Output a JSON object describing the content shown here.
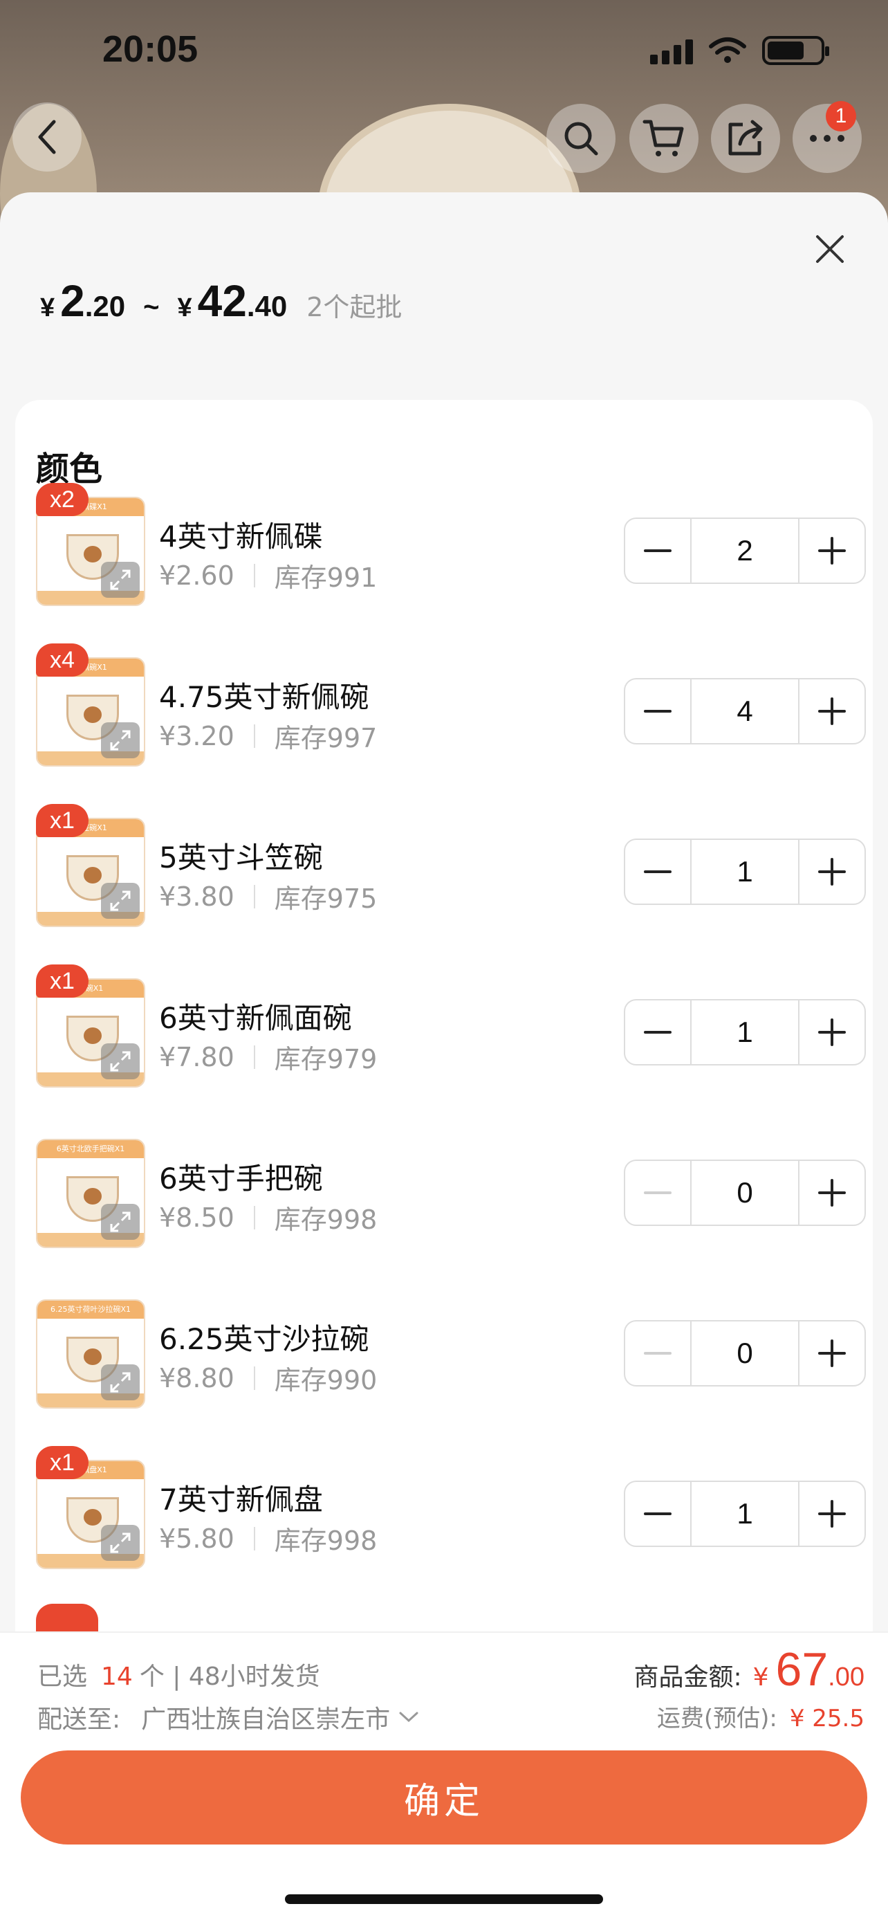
{
  "status": {
    "time": "20:05"
  },
  "header": {
    "cart_badge": "1"
  },
  "price": {
    "min_yen": "¥",
    "min_int": "2",
    "min_dec": ".20",
    "tilde": "~",
    "max_yen": "¥",
    "max_int": "42",
    "max_dec": ".40",
    "moq": "2个起批"
  },
  "section_title": "颜色",
  "items": [
    {
      "name": "4英寸新佩碟",
      "price": "¥2.60",
      "stock": "库存991",
      "qty": "2",
      "badge": "x2",
      "strip": "新佩碟X1"
    },
    {
      "name": "4.75英寸新佩碗",
      "price": "¥3.20",
      "stock": "库存997",
      "qty": "4",
      "badge": "x4",
      "strip": "新佩碗X1"
    },
    {
      "name": "5英寸斗笠碗",
      "price": "¥3.80",
      "stock": "库存975",
      "qty": "1",
      "badge": "x1",
      "strip": "斗笠碗X1"
    },
    {
      "name": "6英寸新佩面碗",
      "price": "¥7.80",
      "stock": "库存979",
      "qty": "1",
      "badge": "x1",
      "strip": "面碗X1"
    },
    {
      "name": "6英寸手把碗",
      "price": "¥8.50",
      "stock": "库存998",
      "qty": "0",
      "badge": "",
      "strip": "6英寸北欧手把碗X1"
    },
    {
      "name": "6.25英寸沙拉碗",
      "price": "¥8.80",
      "stock": "库存990",
      "qty": "0",
      "badge": "",
      "strip": "6.25英寸荷叶沙拉碗X1"
    },
    {
      "name": "7英寸新佩盘",
      "price": "¥5.80",
      "stock": "库存998",
      "qty": "1",
      "badge": "x1",
      "strip": "新佩盘X1"
    }
  ],
  "footer": {
    "selected_prefix": "已选",
    "selected_count": "14",
    "selected_suffix": "个 | 48小时发货",
    "ship_label": "配送至:",
    "ship_dest": "广西壮族自治区崇左市",
    "total_label": "商品金额:",
    "total_yen": "¥",
    "total_int": "67",
    "total_dec": ".00",
    "freight_label": "运费(预估):",
    "freight_amount": "¥ 25.5",
    "confirm": "确定"
  },
  "colors": {
    "accent": "#ee6a3f",
    "price_red": "#e8432e"
  }
}
